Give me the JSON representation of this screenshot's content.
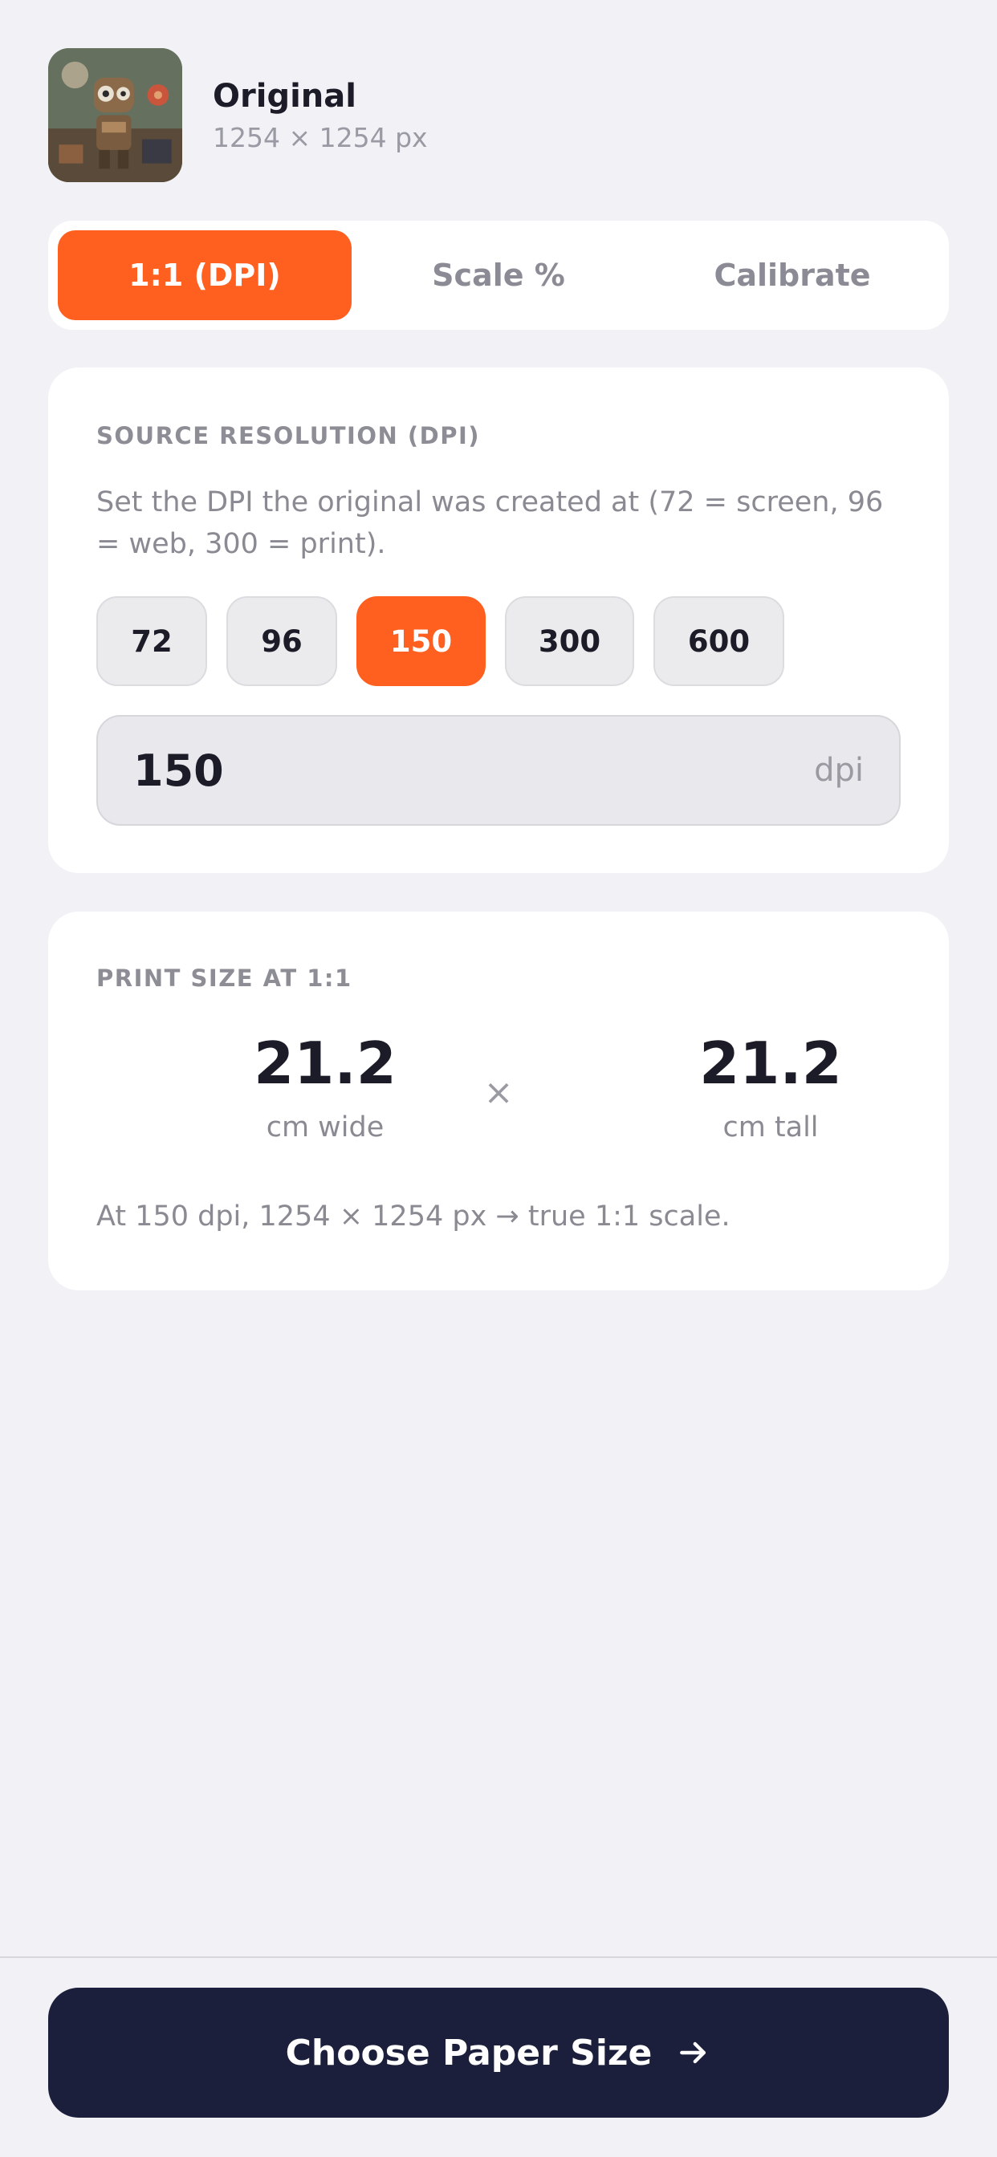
{
  "header": {
    "title": "Original",
    "dimensions": "1254 × 1254 px"
  },
  "tabs": [
    {
      "label": "1:1 (DPI)",
      "active": true
    },
    {
      "label": "Scale %",
      "active": false
    },
    {
      "label": "Calibrate",
      "active": false
    }
  ],
  "resolution": {
    "section_label": "SOURCE RESOLUTION (DPI)",
    "description": "Set the DPI the original was created at (72 = screen, 96 = web, 300 = print).",
    "presets": [
      "72",
      "96",
      "150",
      "300",
      "600"
    ],
    "selected_preset": "150",
    "input_value": "150",
    "input_unit": "dpi"
  },
  "print_size": {
    "section_label": "PRINT SIZE AT 1:1",
    "width_value": "21.2",
    "width_label": "cm wide",
    "times_symbol": "×",
    "height_value": "21.2",
    "height_label": "cm tall",
    "note": "At 150 dpi, 1254 × 1254 px → true 1:1 scale."
  },
  "footer": {
    "cta_label": "Choose Paper Size",
    "cta_icon": "arrow-right-icon"
  },
  "colors": {
    "accent": "#ff5f1f",
    "cta_background": "#1c1f3b",
    "page_background": "#f1f1f6"
  }
}
